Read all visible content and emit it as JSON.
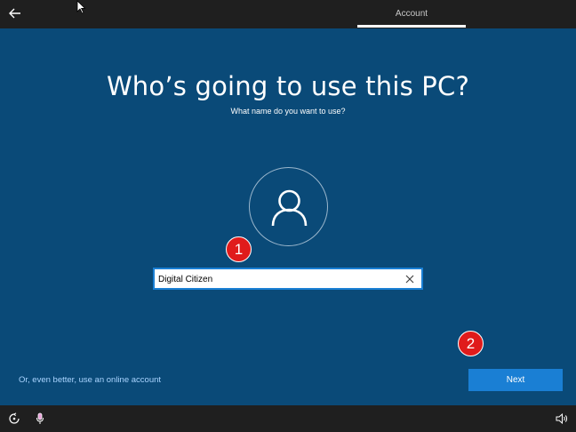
{
  "topbar": {
    "back_icon": "back-arrow-icon",
    "tab_label": "Account"
  },
  "main": {
    "heading": "Who’s going to use this PC?",
    "subheading": "What name do you want to use?",
    "avatar_icon": "user-icon",
    "name_input": {
      "value": "Digital Citizen",
      "clear_icon": "close-icon"
    },
    "online_link": "Or, even better, use an online account",
    "next_label": "Next"
  },
  "badges": {
    "step1": "1",
    "step2": "2"
  },
  "bottombar": {
    "icons": [
      "ease-of-access-icon",
      "microphone-icon",
      "volume-icon"
    ]
  },
  "colors": {
    "background": "#0a4a78",
    "bar": "#1f1f1f",
    "accent": "#1a7fd4",
    "link": "#a9d4ff",
    "badge": "#e01b1b"
  }
}
